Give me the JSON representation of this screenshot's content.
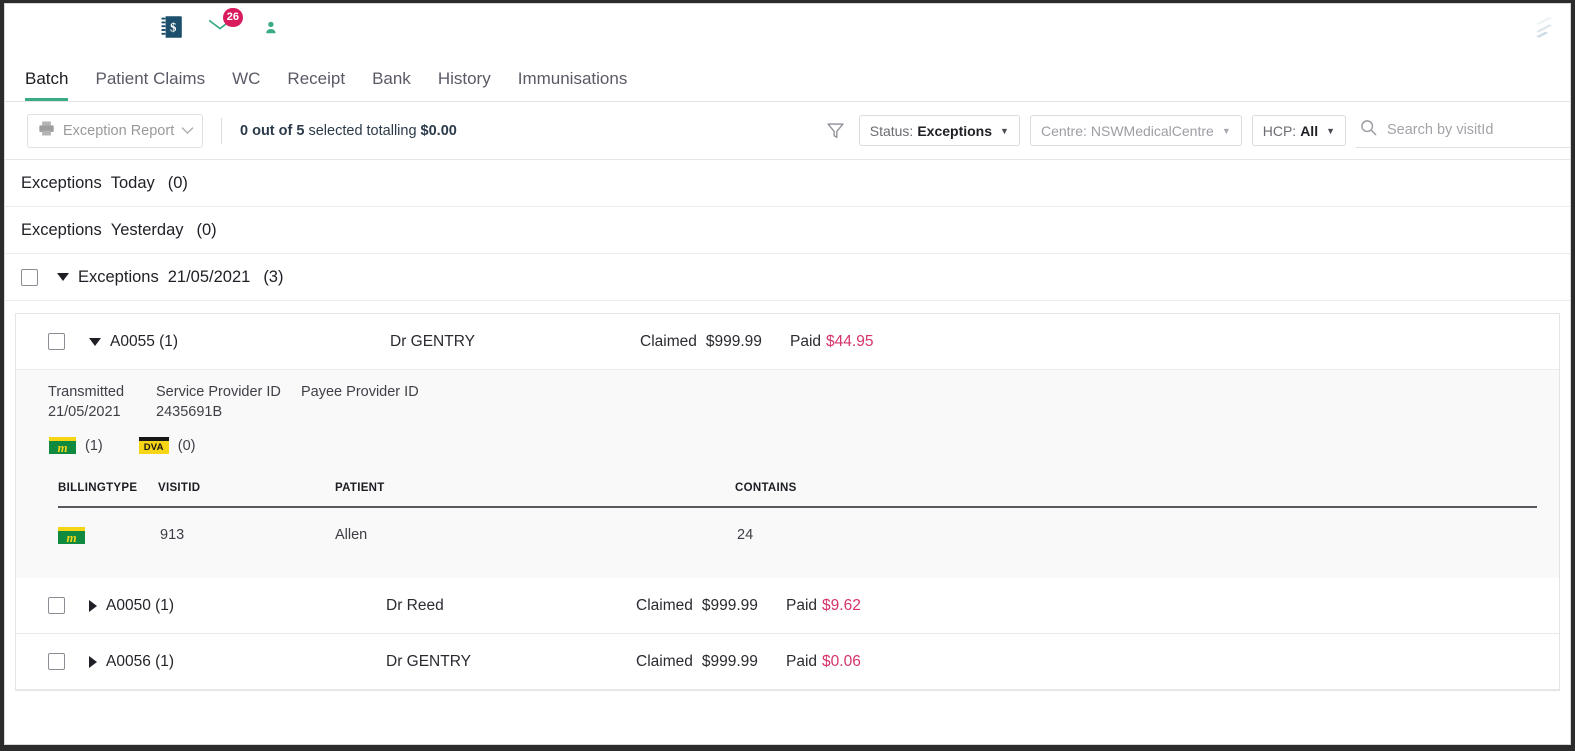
{
  "topbar": {
    "icons": [
      {
        "name": "patient-icon",
        "active": false
      },
      {
        "name": "patients-group-icon",
        "active": false
      },
      {
        "name": "calendar-icon",
        "active": false
      },
      {
        "name": "billing-ledger-icon",
        "active": true
      },
      {
        "name": "mail-icon",
        "active": false,
        "badge": "26"
      },
      {
        "name": "address-book-icon",
        "active": false
      },
      {
        "name": "reports-pie-icon",
        "active": false
      }
    ],
    "logo": "brand-logo"
  },
  "tabs": [
    {
      "label": "Batch",
      "active": true
    },
    {
      "label": "Patient Claims",
      "active": false
    },
    {
      "label": "WC",
      "active": false
    },
    {
      "label": "Receipt",
      "active": false
    },
    {
      "label": "Bank",
      "active": false
    },
    {
      "label": "History",
      "active": false
    },
    {
      "label": "Immunisations",
      "active": false
    }
  ],
  "toolbar": {
    "report_select": "Exception Report",
    "selection_prefix": "0 out of ",
    "selection_count": "5",
    "selection_middle": " selected totalling ",
    "selection_total": "$0.00",
    "status_filter": {
      "key": "Status:",
      "value": "Exceptions"
    },
    "centre_filter": {
      "key": "Centre:",
      "value": "NSWMedicalCentre"
    },
    "hcp_filter": {
      "key": "HCP:",
      "value": "All"
    },
    "search_placeholder": "Search by visitId",
    "search_value": ""
  },
  "groups": [
    {
      "label": "Exceptions",
      "sub": "Today",
      "count": "(0)",
      "has_checkbox": false,
      "expanded": false
    },
    {
      "label": "Exceptions",
      "sub": "Yesterday",
      "count": "(0)",
      "has_checkbox": false,
      "expanded": false
    },
    {
      "label": "Exceptions",
      "sub": "21/05/2021",
      "count": "(3)",
      "has_checkbox": true,
      "expanded": true
    }
  ],
  "claims": [
    {
      "id": "A0055 (1)",
      "doctor": "Dr GENTRY",
      "claimed_label": "Claimed",
      "claimed_amount": "$999.99",
      "paid_label": "Paid",
      "paid_amount": "$44.95",
      "expanded": true,
      "detail": {
        "transmitted_label": "Transmitted",
        "transmitted_value": "21/05/2021",
        "service_provider_label": "Service Provider ID",
        "service_provider_value": "2435691B",
        "payee_provider_label": "Payee Provider ID",
        "payee_provider_value": "",
        "medicare_count": "(1)",
        "dva_count": "(0)",
        "table": {
          "headers": [
            "BILLINGTYPE",
            "VISITID",
            "PATIENT",
            "CONTAINS"
          ],
          "rows": [
            {
              "billingtype": "medicare-badge",
              "visitid": "913",
              "patient": "Allen",
              "contains": "24"
            }
          ]
        }
      }
    },
    {
      "id": "A0050 (1)",
      "doctor": "Dr Reed",
      "claimed_label": "Claimed",
      "claimed_amount": "$999.99",
      "paid_label": "Paid",
      "paid_amount": "$9.62",
      "expanded": false
    },
    {
      "id": "A0056 (1)",
      "doctor": "Dr GENTRY",
      "claimed_label": "Claimed",
      "claimed_amount": "$999.99",
      "paid_label": "Paid",
      "paid_amount": "$0.06",
      "expanded": false
    }
  ],
  "colors": {
    "accent_green": "#3aab87",
    "header_dark": "#194b60",
    "paid_amount": "#d6336c",
    "badge_red": "#d81b5e",
    "medicare_green": "#0f8a3e",
    "medicare_yellow": "#f6d416"
  }
}
